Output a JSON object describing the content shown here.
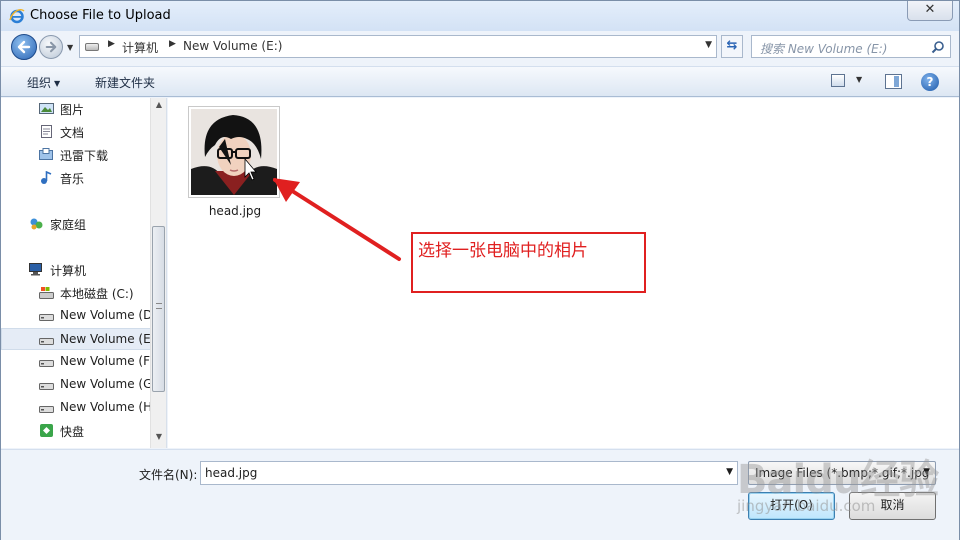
{
  "window": {
    "title": "Choose File to Upload",
    "close_glyph": "✕"
  },
  "nav": {
    "address_crumbs": [
      "计算机",
      "New Volume (E:)"
    ],
    "search_placeholder": "搜索 New Volume (E:)"
  },
  "toolbar": {
    "organize": "组织",
    "new_folder": "新建文件夹",
    "help_glyph": "?"
  },
  "sidebar": {
    "items": [
      {
        "label": "图片",
        "icon": "pictures-icon"
      },
      {
        "label": "文档",
        "icon": "documents-icon"
      },
      {
        "label": "迅雷下载",
        "icon": "download-folder-icon"
      },
      {
        "label": "音乐",
        "icon": "music-icon"
      },
      {
        "label": "家庭组",
        "icon": "homegroup-icon"
      },
      {
        "label": "计算机",
        "icon": "computer-icon"
      },
      {
        "label": "本地磁盘 (C:)",
        "icon": "system-drive-icon"
      },
      {
        "label": "New Volume (D:)",
        "icon": "drive-icon"
      },
      {
        "label": "New Volume (E:)",
        "icon": "drive-icon",
        "selected": true
      },
      {
        "label": "New Volume (F:)",
        "icon": "drive-icon"
      },
      {
        "label": "New Volume (G:)",
        "icon": "drive-icon"
      },
      {
        "label": "New Volume (H:)",
        "icon": "drive-icon"
      },
      {
        "label": "快盘",
        "icon": "kuaipan-icon"
      }
    ]
  },
  "content": {
    "files": [
      {
        "name": "head.jpg",
        "type": "image-thumbnail"
      }
    ],
    "annotation": "选择一张电脑中的相片",
    "annotation_color": "#e02020"
  },
  "footer": {
    "filename_label": "文件名(N):",
    "filename_value": "head.jpg",
    "filter_value": "Image Files (*.bmp;*.gif;*.jpg",
    "open_label": "打开(O)",
    "cancel_label": "取消"
  },
  "watermark": {
    "main": "Baidu经验",
    "sub": "jingyan.baidu.com"
  }
}
